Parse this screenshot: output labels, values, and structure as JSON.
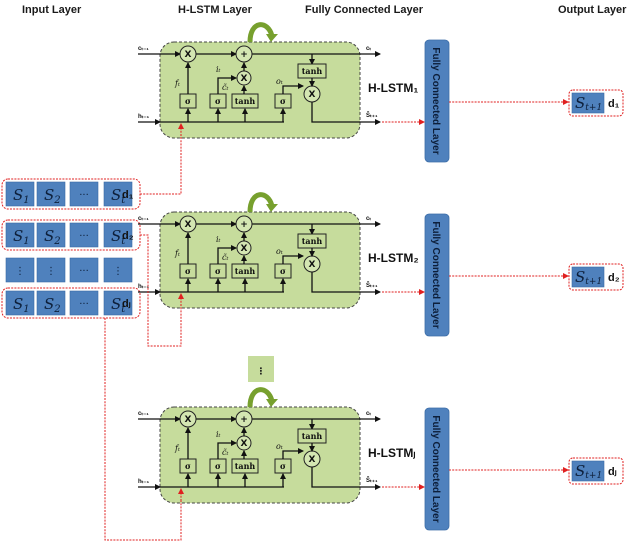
{
  "headers": {
    "input": "Input  Layer",
    "hlstm": "H-LSTM  Layer",
    "fc": "Fully Connected Layer",
    "output": "Output  Layer"
  },
  "input_rows": [
    {
      "cells": [
        "S",
        "S",
        "···",
        "S"
      ],
      "subs": [
        "1",
        "2",
        "",
        "t"
      ],
      "label": "d₁"
    },
    {
      "cells": [
        "S",
        "S",
        "···",
        "S"
      ],
      "subs": [
        "1",
        "2",
        "",
        "t"
      ],
      "label": "d₂"
    },
    {
      "cells": [
        "⋮",
        "⋮",
        "···",
        "⋮"
      ],
      "subs": [
        "",
        "",
        "",
        ""
      ],
      "label": ""
    },
    {
      "cells": [
        "S",
        "S",
        "···",
        "S"
      ],
      "subs": [
        "1",
        "2",
        "",
        "t"
      ],
      "label": "dⱼ"
    }
  ],
  "cells": [
    {
      "name": "H-LSTM₁"
    },
    {
      "name": "H-LSTM₂"
    },
    {
      "name": "H-LSTMⱼ"
    }
  ],
  "cell_labels": {
    "c_in": "cₜ₋₁",
    "h_in": "hₜ₋₁",
    "c_out": "cₜ",
    "s_out": "Ŝₜ₊₁",
    "f": "fₜ",
    "i": "iₜ",
    "ctilde": "c̃ₜ",
    "o": "oₜ",
    "sigma": "σ",
    "tanh": "tanh",
    "mult": "X",
    "add": "+"
  },
  "ellipsis": "⋮",
  "fc_label": "Fully Connected Layer",
  "outputs": [
    {
      "cell": "S",
      "sub": "t+1",
      "label": "d₁"
    },
    {
      "cell": "S",
      "sub": "t+1",
      "label": "d₂"
    },
    {
      "cell": "S",
      "sub": "t+1",
      "label": "dⱼ"
    }
  ],
  "colors": {
    "cell_bg": "#c6dc9c",
    "blue": "#4f81bd",
    "red_dashed": "#e02020",
    "green_arrow": "#77a02e"
  }
}
